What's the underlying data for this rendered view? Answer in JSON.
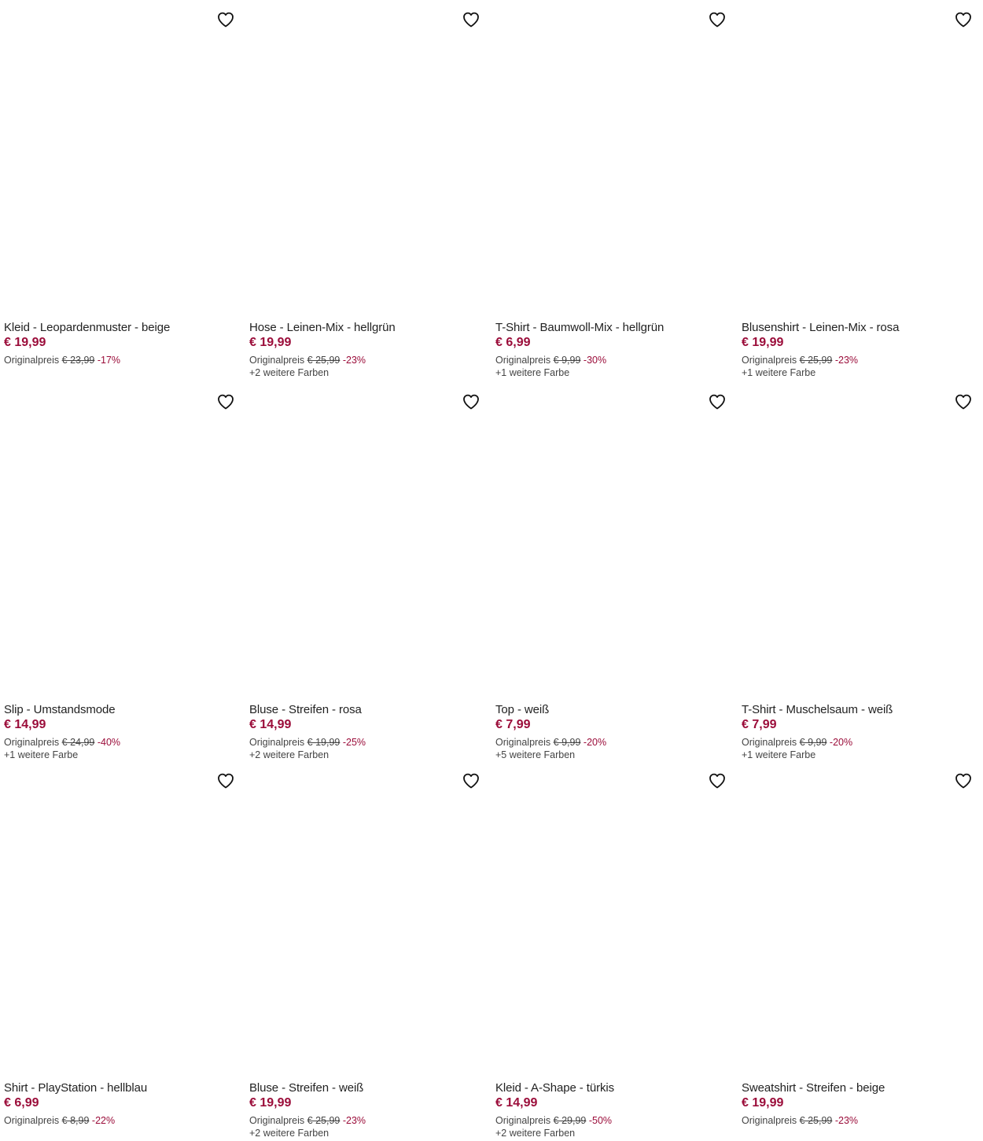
{
  "products": [
    {
      "title": "Kleid - Leopardenmuster - beige",
      "price": "€ 19,99",
      "orig_label": "Originalpreis",
      "orig_price": "€ 23,99",
      "discount": "-17%",
      "colors": ""
    },
    {
      "title": "Hose - Leinen-Mix - hellgrün",
      "price": "€ 19,99",
      "orig_label": "Originalpreis",
      "orig_price": "€ 25,99",
      "discount": "-23%",
      "colors": "+2 weitere Farben"
    },
    {
      "title": "T-Shirt - Baumwoll-Mix - hellgrün",
      "price": "€ 6,99",
      "orig_label": "Originalpreis",
      "orig_price": "€ 9,99",
      "discount": "-30%",
      "colors": "+1 weitere Farbe"
    },
    {
      "title": "Blusenshirt - Leinen-Mix - rosa",
      "price": "€ 19,99",
      "orig_label": "Originalpreis",
      "orig_price": "€ 25,99",
      "discount": "-23%",
      "colors": "+1 weitere Farbe"
    },
    {
      "title": "Slip - Umstandsmode",
      "price": "€ 14,99",
      "orig_label": "Originalpreis",
      "orig_price": "€ 24,99",
      "discount": "-40%",
      "colors": "+1 weitere Farbe"
    },
    {
      "title": "Bluse - Streifen - rosa",
      "price": "€ 14,99",
      "orig_label": "Originalpreis",
      "orig_price": "€ 19,99",
      "discount": "-25%",
      "colors": "+2 weitere Farben"
    },
    {
      "title": "Top - weiß",
      "price": "€ 7,99",
      "orig_label": "Originalpreis",
      "orig_price": "€ 9,99",
      "discount": "-20%",
      "colors": "+5 weitere Farben"
    },
    {
      "title": "T-Shirt - Muschelsaum - weiß",
      "price": "€ 7,99",
      "orig_label": "Originalpreis",
      "orig_price": "€ 9,99",
      "discount": "-20%",
      "colors": "+1 weitere Farbe"
    },
    {
      "title": "Shirt - PlayStation - hellblau",
      "price": "€ 6,99",
      "orig_label": "Originalpreis",
      "orig_price": "€ 8,99",
      "discount": "-22%",
      "colors": ""
    },
    {
      "title": "Bluse - Streifen - weiß",
      "price": "€ 19,99",
      "orig_label": "Originalpreis",
      "orig_price": "€ 25,99",
      "discount": "-23%",
      "colors": "+2 weitere Farben"
    },
    {
      "title": "Kleid - A-Shape - türkis",
      "price": "€ 14,99",
      "orig_label": "Originalpreis",
      "orig_price": "€ 29,99",
      "discount": "-50%",
      "colors": "+2 weitere Farben"
    },
    {
      "title": "Sweatshirt - Streifen - beige",
      "price": "€ 19,99",
      "orig_label": "Originalpreis",
      "orig_price": "€ 25,99",
      "discount": "-23%",
      "colors": ""
    }
  ],
  "colors": {
    "price": "#9b0d3a",
    "text": "#222222"
  },
  "icons": {
    "favorite": "heart-outline-icon"
  }
}
